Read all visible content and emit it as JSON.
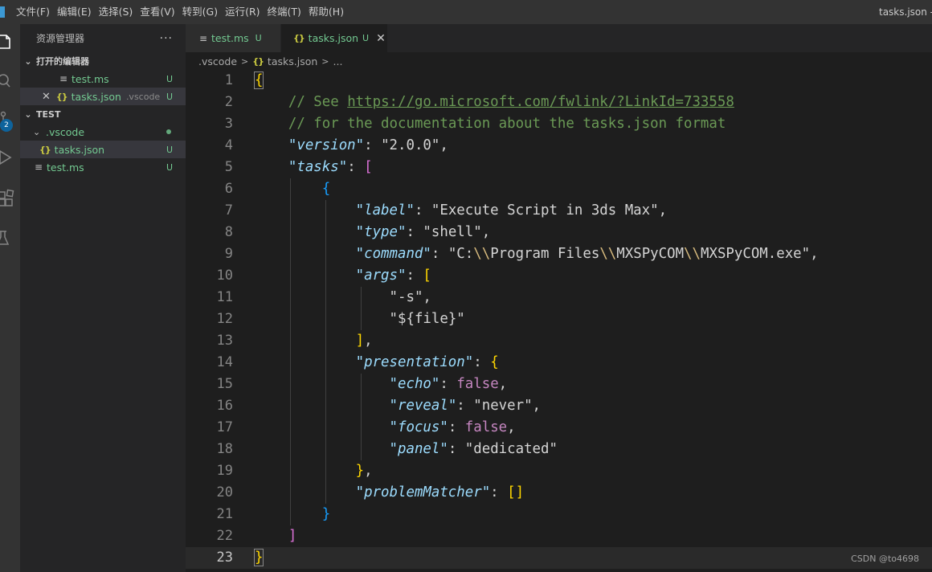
{
  "window": {
    "title": "tasks.json - te"
  },
  "menu": [
    "文件(F)",
    "编辑(E)",
    "选择(S)",
    "查看(V)",
    "转到(G)",
    "运行(R)",
    "终端(T)",
    "帮助(H)"
  ],
  "activity_bar": {
    "scm_badge": "2",
    "icons": [
      "files-icon",
      "search-icon",
      "source-control-icon",
      "run-debug-icon",
      "extensions-icon",
      "testing-icon"
    ]
  },
  "sidebar": {
    "title": "资源管理器",
    "more": "···",
    "open_editors": {
      "label": "打开的编辑器",
      "items": [
        {
          "name": "test.ms",
          "status": "U"
        },
        {
          "name": "tasks.json",
          "desc": ".vscode",
          "status": "U"
        }
      ]
    },
    "folder": {
      "label": "TEST",
      "items": [
        {
          "name": ".vscode"
        },
        {
          "name": "tasks.json",
          "status": "U"
        },
        {
          "name": "test.ms",
          "status": "U"
        }
      ]
    }
  },
  "tabs": [
    {
      "name": "test.ms",
      "status": "U"
    },
    {
      "name": "tasks.json",
      "status": "U"
    }
  ],
  "breadcrumb": {
    "folder": ".vscode",
    "file": "tasks.json",
    "symbol": "..."
  },
  "editor": {
    "line_numbers": [
      "1",
      "2",
      "3",
      "4",
      "5",
      "6",
      "7",
      "8",
      "9",
      "10",
      "11",
      "12",
      "13",
      "14",
      "15",
      "16",
      "17",
      "18",
      "19",
      "20",
      "21",
      "22",
      "23"
    ],
    "tokens": {
      "l2_cmt": "// See ",
      "l2_url": "https://go.microsoft.com/fwlink/?LinkId=733558",
      "l3_cmt": "// for the documentation about the tasks.json format",
      "k_version": "\"version\"",
      "v_version": "\"2.0.0\"",
      "k_tasks": "\"tasks\"",
      "k_label": "\"label\"",
      "v_label": "\"Execute Script in 3ds Max\"",
      "k_type": "\"type\"",
      "v_type": "\"shell\"",
      "k_command": "\"command\"",
      "v_cmd_1": "\"C:",
      "v_cmd_esc": "\\\\",
      "v_cmd_2": "Program Files",
      "v_cmd_3": "MXSPyCOM",
      "v_cmd_4": "MXSPyCOM.exe\"",
      "k_args": "\"args\"",
      "v_arg1": "\"-s\"",
      "v_arg2": "\"${file}\"",
      "k_presentation": "\"presentation\"",
      "k_echo": "\"echo\"",
      "v_false": "false",
      "k_reveal": "\"reveal\"",
      "v_reveal": "\"never\"",
      "k_focus": "\"focus\"",
      "k_panel": "\"panel\"",
      "v_panel": "\"dedicated\"",
      "k_problemMatcher": "\"problemMatcher\""
    }
  },
  "watermark": "CSDN @to4698",
  "colors": {
    "accent": "#0e639c",
    "untracked_green": "#73c991",
    "json_icon": "#cbcb41"
  }
}
